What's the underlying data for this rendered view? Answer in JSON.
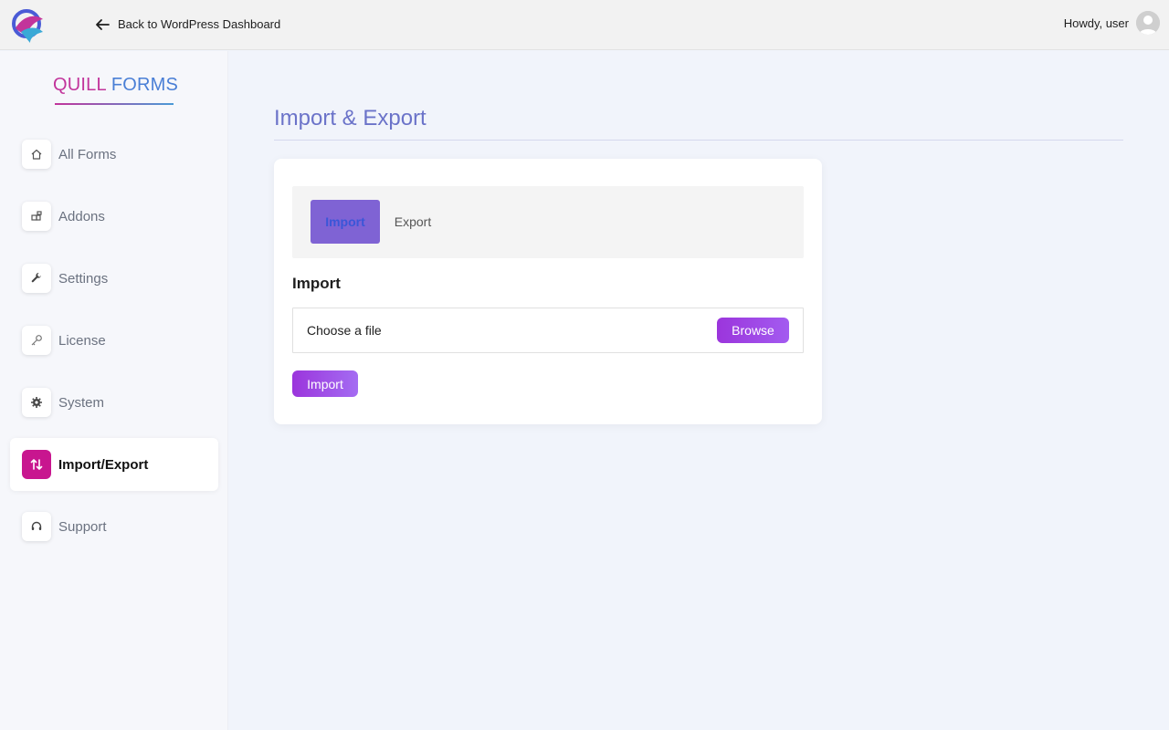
{
  "topbar": {
    "back_label": "Back to WordPress Dashboard",
    "greeting": "Howdy, user",
    "logo_icon": "quill-forms-logo-icon",
    "back_icon": "arrow-left-icon",
    "avatar_icon": "user-avatar-icon"
  },
  "sidebar": {
    "brand_first": "QUILL",
    "brand_second": "FORMS",
    "items": [
      {
        "label": "All Forms",
        "icon": "home-icon"
      },
      {
        "label": "Addons",
        "icon": "addons-icon"
      },
      {
        "label": "Settings",
        "icon": "wrench-icon"
      },
      {
        "label": "License",
        "icon": "key-icon"
      },
      {
        "label": "System",
        "icon": "gear-icon"
      },
      {
        "label": "Import/Export",
        "icon": "import-export-icon",
        "active": true
      },
      {
        "label": "Support",
        "icon": "headset-icon"
      }
    ]
  },
  "main": {
    "page_title": "Import & Export",
    "tabs": [
      {
        "label": "Import",
        "active": true
      },
      {
        "label": "Export",
        "active": false
      }
    ],
    "section_title": "Import",
    "file_input": {
      "text": "Choose a file",
      "browse_label": "Browse"
    },
    "import_button": "Import"
  },
  "colors": {
    "accent": "#c8168f",
    "primary_button": "#9b35dc",
    "title": "#6b73c9",
    "active_tab_bg": "#7f63d4"
  }
}
